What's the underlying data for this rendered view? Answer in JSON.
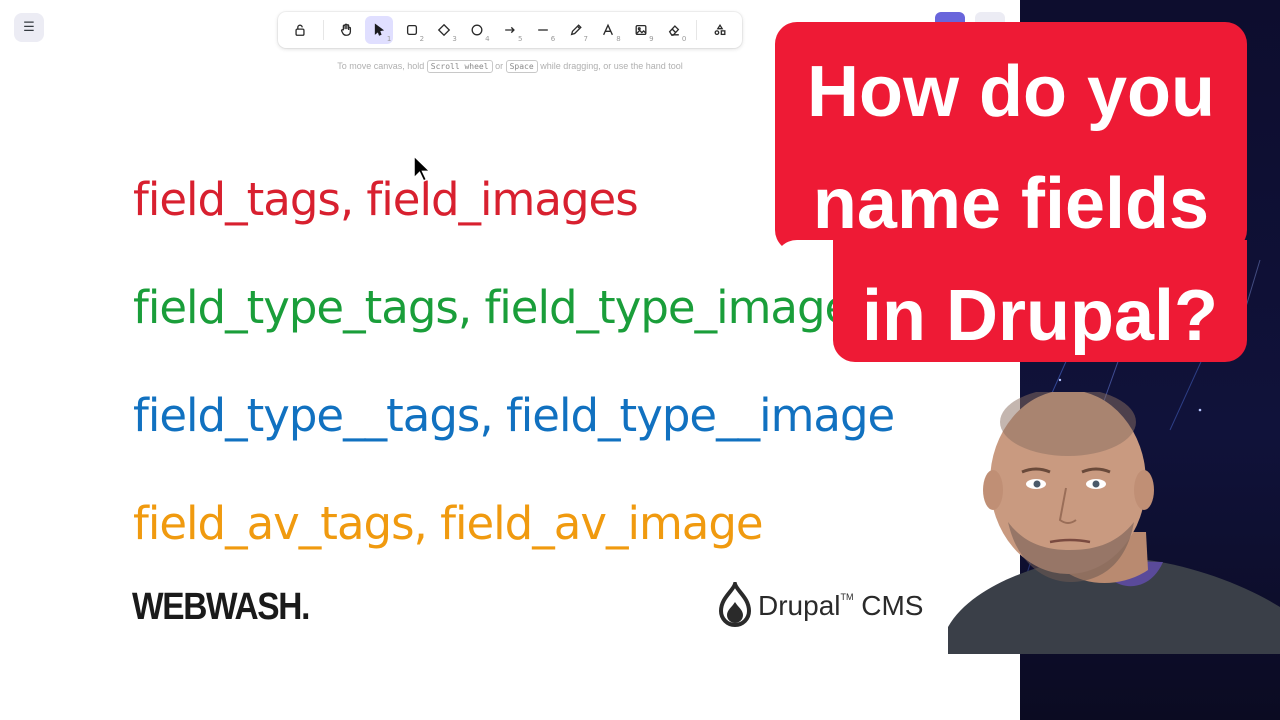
{
  "toolbar": {
    "tools": [
      {
        "name": "lock",
        "num": ""
      },
      {
        "name": "hand",
        "num": ""
      },
      {
        "name": "selection",
        "num": "1"
      },
      {
        "name": "rectangle",
        "num": "2"
      },
      {
        "name": "diamond",
        "num": "3"
      },
      {
        "name": "ellipse",
        "num": "4"
      },
      {
        "name": "arrow",
        "num": "5"
      },
      {
        "name": "line",
        "num": "6"
      },
      {
        "name": "draw",
        "num": "7"
      },
      {
        "name": "text",
        "num": "8"
      },
      {
        "name": "image",
        "num": "9"
      },
      {
        "name": "eraser",
        "num": "0"
      },
      {
        "name": "extra-tools",
        "num": ""
      }
    ],
    "active_tool": "selection"
  },
  "hint": {
    "before": "To move canvas, hold",
    "key1": "Scroll wheel",
    "or": "or",
    "key2": "Space",
    "after": "while dragging, or use the hand tool"
  },
  "canvas": {
    "lines": [
      {
        "text": "field_tags, field_images",
        "color": "#d8202f"
      },
      {
        "text": "field_type_tags, field_type_images",
        "color": "#1a9e3a"
      },
      {
        "text": "field_type__tags, field_type__image",
        "color": "#1171c0"
      },
      {
        "text": "field_av_tags, field_av_image",
        "color": "#f09a0f"
      }
    ],
    "brand_webwash": "WEBWASH.",
    "brand_drupal": "Drupal",
    "brand_drupal_tm": "TM",
    "brand_drupal_cms": "CMS"
  },
  "callout": {
    "line1": "How do you",
    "line2": "name fields",
    "line3": "in Drupal?",
    "color": "#ee1a35"
  },
  "colors": {
    "accent": "#6965db",
    "dark_panel": "#0d0d2e"
  }
}
